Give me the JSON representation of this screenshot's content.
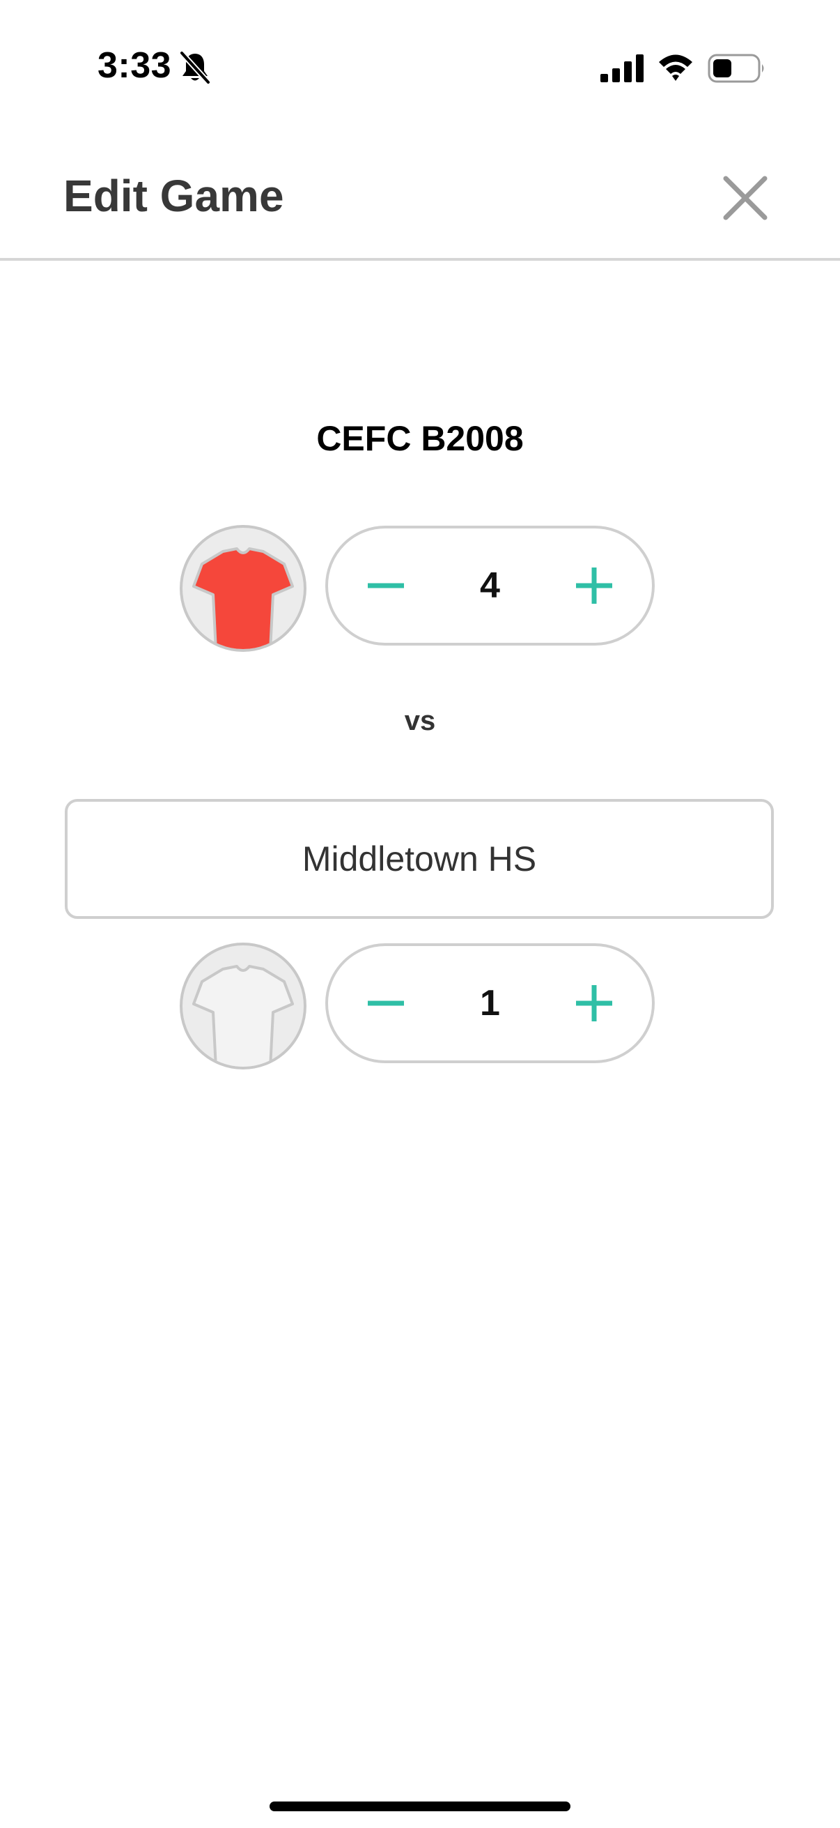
{
  "status_bar": {
    "time": "3:33",
    "icons": [
      "bell-slash-icon",
      "cellular-signal-icon",
      "wifi-icon",
      "battery-icon"
    ]
  },
  "header": {
    "title": "Edit Game",
    "close_icon": "close-icon"
  },
  "home_team": {
    "name": "CEFC B2008",
    "jersey_color": "#f5473b",
    "score": "4"
  },
  "vs_label": "vs",
  "away_team": {
    "name_value": "Middletown HS",
    "jersey_color": "#f3f3f3",
    "score": "1"
  },
  "stepper": {
    "accent_color": "#2fbfa6",
    "minus_icon": "minus-icon",
    "plus_icon": "plus-icon"
  }
}
